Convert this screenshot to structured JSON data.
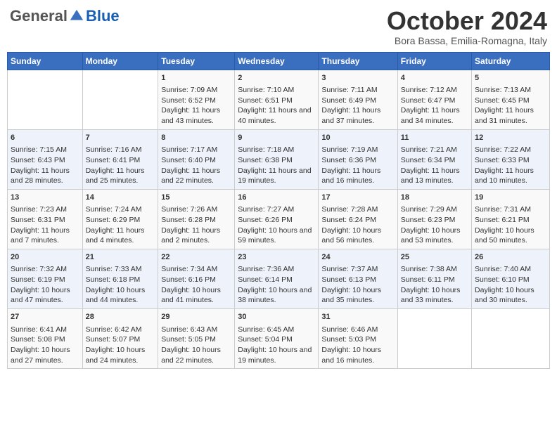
{
  "header": {
    "logo_general": "General",
    "logo_blue": "Blue",
    "month_title": "October 2024",
    "subtitle": "Bora Bassa, Emilia-Romagna, Italy"
  },
  "days_of_week": [
    "Sunday",
    "Monday",
    "Tuesday",
    "Wednesday",
    "Thursday",
    "Friday",
    "Saturday"
  ],
  "weeks": [
    [
      {
        "day": "",
        "content": ""
      },
      {
        "day": "",
        "content": ""
      },
      {
        "day": "1",
        "content": "Sunrise: 7:09 AM\nSunset: 6:52 PM\nDaylight: 11 hours and 43 minutes."
      },
      {
        "day": "2",
        "content": "Sunrise: 7:10 AM\nSunset: 6:51 PM\nDaylight: 11 hours and 40 minutes."
      },
      {
        "day": "3",
        "content": "Sunrise: 7:11 AM\nSunset: 6:49 PM\nDaylight: 11 hours and 37 minutes."
      },
      {
        "day": "4",
        "content": "Sunrise: 7:12 AM\nSunset: 6:47 PM\nDaylight: 11 hours and 34 minutes."
      },
      {
        "day": "5",
        "content": "Sunrise: 7:13 AM\nSunset: 6:45 PM\nDaylight: 11 hours and 31 minutes."
      }
    ],
    [
      {
        "day": "6",
        "content": "Sunrise: 7:15 AM\nSunset: 6:43 PM\nDaylight: 11 hours and 28 minutes."
      },
      {
        "day": "7",
        "content": "Sunrise: 7:16 AM\nSunset: 6:41 PM\nDaylight: 11 hours and 25 minutes."
      },
      {
        "day": "8",
        "content": "Sunrise: 7:17 AM\nSunset: 6:40 PM\nDaylight: 11 hours and 22 minutes."
      },
      {
        "day": "9",
        "content": "Sunrise: 7:18 AM\nSunset: 6:38 PM\nDaylight: 11 hours and 19 minutes."
      },
      {
        "day": "10",
        "content": "Sunrise: 7:19 AM\nSunset: 6:36 PM\nDaylight: 11 hours and 16 minutes."
      },
      {
        "day": "11",
        "content": "Sunrise: 7:21 AM\nSunset: 6:34 PM\nDaylight: 11 hours and 13 minutes."
      },
      {
        "day": "12",
        "content": "Sunrise: 7:22 AM\nSunset: 6:33 PM\nDaylight: 11 hours and 10 minutes."
      }
    ],
    [
      {
        "day": "13",
        "content": "Sunrise: 7:23 AM\nSunset: 6:31 PM\nDaylight: 11 hours and 7 minutes."
      },
      {
        "day": "14",
        "content": "Sunrise: 7:24 AM\nSunset: 6:29 PM\nDaylight: 11 hours and 4 minutes."
      },
      {
        "day": "15",
        "content": "Sunrise: 7:26 AM\nSunset: 6:28 PM\nDaylight: 11 hours and 2 minutes."
      },
      {
        "day": "16",
        "content": "Sunrise: 7:27 AM\nSunset: 6:26 PM\nDaylight: 10 hours and 59 minutes."
      },
      {
        "day": "17",
        "content": "Sunrise: 7:28 AM\nSunset: 6:24 PM\nDaylight: 10 hours and 56 minutes."
      },
      {
        "day": "18",
        "content": "Sunrise: 7:29 AM\nSunset: 6:23 PM\nDaylight: 10 hours and 53 minutes."
      },
      {
        "day": "19",
        "content": "Sunrise: 7:31 AM\nSunset: 6:21 PM\nDaylight: 10 hours and 50 minutes."
      }
    ],
    [
      {
        "day": "20",
        "content": "Sunrise: 7:32 AM\nSunset: 6:19 PM\nDaylight: 10 hours and 47 minutes."
      },
      {
        "day": "21",
        "content": "Sunrise: 7:33 AM\nSunset: 6:18 PM\nDaylight: 10 hours and 44 minutes."
      },
      {
        "day": "22",
        "content": "Sunrise: 7:34 AM\nSunset: 6:16 PM\nDaylight: 10 hours and 41 minutes."
      },
      {
        "day": "23",
        "content": "Sunrise: 7:36 AM\nSunset: 6:14 PM\nDaylight: 10 hours and 38 minutes."
      },
      {
        "day": "24",
        "content": "Sunrise: 7:37 AM\nSunset: 6:13 PM\nDaylight: 10 hours and 35 minutes."
      },
      {
        "day": "25",
        "content": "Sunrise: 7:38 AM\nSunset: 6:11 PM\nDaylight: 10 hours and 33 minutes."
      },
      {
        "day": "26",
        "content": "Sunrise: 7:40 AM\nSunset: 6:10 PM\nDaylight: 10 hours and 30 minutes."
      }
    ],
    [
      {
        "day": "27",
        "content": "Sunrise: 6:41 AM\nSunset: 5:08 PM\nDaylight: 10 hours and 27 minutes."
      },
      {
        "day": "28",
        "content": "Sunrise: 6:42 AM\nSunset: 5:07 PM\nDaylight: 10 hours and 24 minutes."
      },
      {
        "day": "29",
        "content": "Sunrise: 6:43 AM\nSunset: 5:05 PM\nDaylight: 10 hours and 22 minutes."
      },
      {
        "day": "30",
        "content": "Sunrise: 6:45 AM\nSunset: 5:04 PM\nDaylight: 10 hours and 19 minutes."
      },
      {
        "day": "31",
        "content": "Sunrise: 6:46 AM\nSunset: 5:03 PM\nDaylight: 10 hours and 16 minutes."
      },
      {
        "day": "",
        "content": ""
      },
      {
        "day": "",
        "content": ""
      }
    ]
  ]
}
